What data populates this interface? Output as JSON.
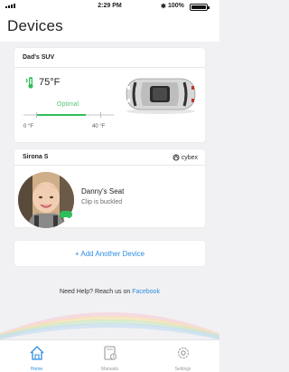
{
  "status_bar": {
    "time": "2:29 PM",
    "bluetooth": "✱",
    "battery": "100%"
  },
  "header": {
    "title": "Devices"
  },
  "car_card": {
    "name": "Dad's SUV",
    "temperature": "75°F",
    "range_label": "Optimal",
    "scale_min": "0 °F",
    "scale_max": "40 °F",
    "optimal_fraction": 0.55
  },
  "seat_card": {
    "device_name": "Sirona S",
    "brand": "cybex",
    "seat_name": "Danny's Seat",
    "seat_status": "Clip is buckled"
  },
  "add_device": {
    "label": "+ Add Another Device"
  },
  "help": {
    "text": "Need Help? Reach us on ",
    "link": "Facebook"
  },
  "tabs": [
    {
      "label": "Home",
      "icon": "home-icon",
      "active": true
    },
    {
      "label": "Manuals",
      "icon": "manual-icon",
      "active": false
    },
    {
      "label": "Settings",
      "icon": "gear-icon",
      "active": false
    }
  ],
  "colors": {
    "accent": "#2d8de2",
    "ok_green": "#2fbf5a"
  }
}
